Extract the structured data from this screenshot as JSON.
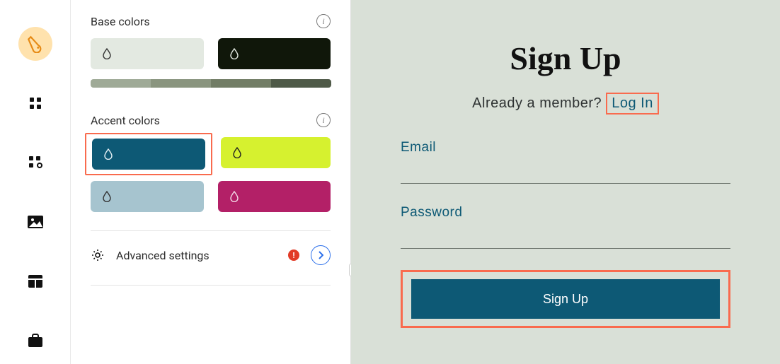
{
  "toolbar": {
    "active_index": 0,
    "icons": [
      "palette-icon",
      "grid-icon",
      "blocks-icon",
      "image-icon",
      "layout-icon",
      "briefcase-icon"
    ]
  },
  "panel": {
    "base": {
      "title": "Base colors",
      "selected_index": null,
      "swatches": [
        {
          "bg": "#E3E9E1",
          "drop_color": "#333333"
        },
        {
          "bg": "#10170A",
          "drop_color": "#E3E9E1"
        }
      ]
    },
    "accent": {
      "title": "Accent colors",
      "selected_index": 0,
      "swatches": [
        {
          "bg": "#0D5975",
          "drop_color": "#E6F0F4"
        },
        {
          "bg": "#D6F12F",
          "drop_color": "#222222"
        },
        {
          "bg": "#A6C4CF",
          "drop_color": "#333333"
        },
        {
          "bg": "#B32067",
          "drop_color": "#F3D8E6"
        }
      ]
    },
    "advanced": {
      "label": "Advanced settings",
      "alert": "!"
    }
  },
  "preview": {
    "title": "Sign Up",
    "member_prefix": "Already a member? ",
    "login_link": "Log In",
    "email_label": "Email",
    "password_label": "Password",
    "button_label": "Sign Up"
  }
}
